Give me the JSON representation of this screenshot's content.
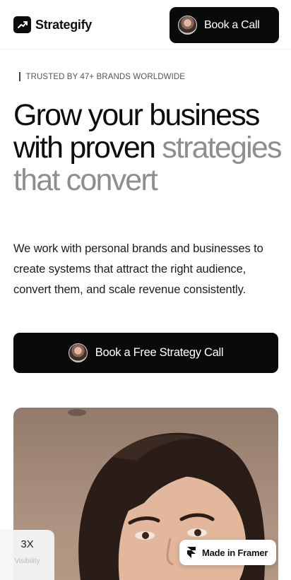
{
  "header": {
    "brand": "Strategify",
    "cta_label": "Book a Call"
  },
  "hero": {
    "trusted": "TRUSTED BY 47+ BRANDS WORLDWIDE",
    "headline_dark": "Grow your business with proven",
    "headline_muted": "strategies that convert",
    "subtext": "We work with personal brands and businesses to create systems that attract the right audience, convert them, and scale revenue consistently.",
    "cta_label": "Book a Free Strategy Call"
  },
  "overlay": {
    "stat_value": "3X",
    "stat_caption": "Visibility",
    "framer_label": "Made in Framer"
  },
  "colors": {
    "primary": "#0a0a0a",
    "muted_text": "#8e8e8e",
    "background": "#ffffff"
  },
  "icons": {
    "logo": "trend-up-arrow-icon",
    "framer": "framer-icon"
  }
}
